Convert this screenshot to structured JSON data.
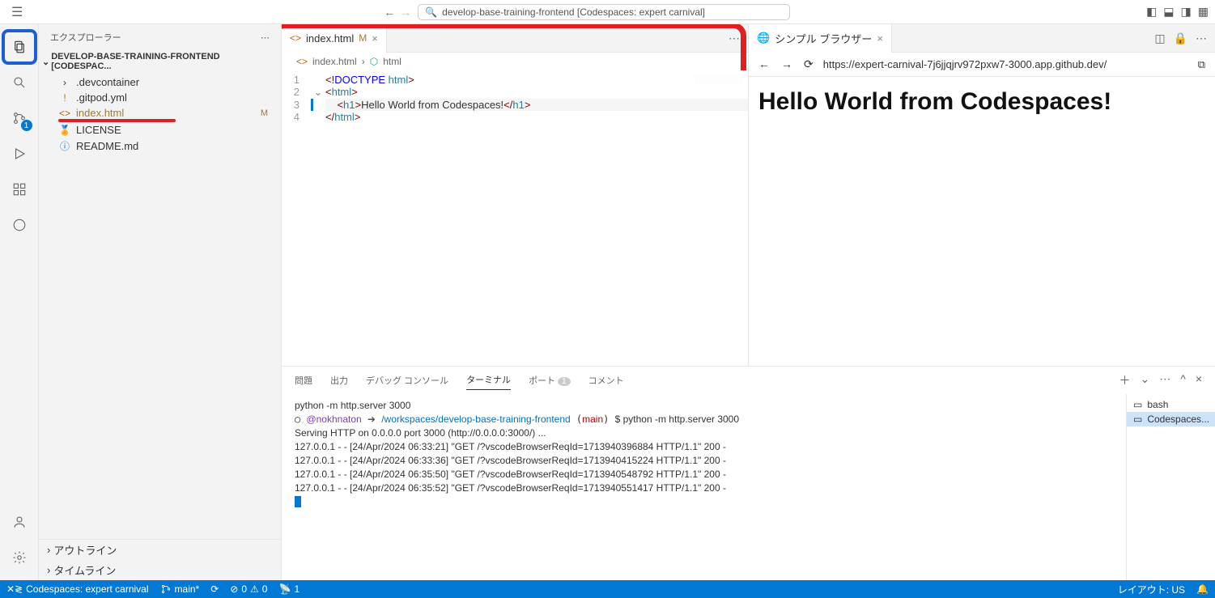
{
  "title_bar": {
    "search_text": "develop-base-training-frontend [Codespaces: expert carnival]"
  },
  "sidebar": {
    "header": "エクスプローラー",
    "project": "DEVELOP-BASE-TRAINING-FRONTEND [CODESPAC...",
    "files": [
      {
        "name": ".devcontainer",
        "icon": "›",
        "modified": false
      },
      {
        "name": ".gitpod.yml",
        "icon": "!",
        "modified": false
      },
      {
        "name": "index.html",
        "icon": "<>",
        "modified": true,
        "status": "M"
      },
      {
        "name": "LICENSE",
        "icon": "🏅",
        "modified": false
      },
      {
        "name": "README.md",
        "icon": "ⓘ",
        "modified": false
      }
    ],
    "outline": "アウトライン",
    "timeline": "タイムライン"
  },
  "editor": {
    "tab_label": "index.html",
    "tab_mod": "M",
    "breadcrumb_1": "index.html",
    "breadcrumb_2": "html",
    "code": {
      "l1": {
        "n": "1",
        "doctype_open": "<!",
        "doctype_kw": "DOCTYPE",
        "doctype_rest": " html",
        "close": ">"
      },
      "l2": {
        "n": "2",
        "open": "<",
        "tag": "html",
        "close": ">"
      },
      "l3": {
        "n": "3",
        "indent": "    ",
        "open": "<",
        "tag": "h1",
        "close": ">",
        "text": "Hello World from Codespaces!",
        "open2": "</",
        "tag2": "h1",
        "close2": ">"
      },
      "l4": {
        "n": "4",
        "open": "</",
        "tag": "html",
        "close": ">"
      }
    }
  },
  "browser": {
    "tab_label": "シンプル ブラウザー",
    "url": "https://expert-carnival-7j6jjqjrv972pxw7-3000.app.github.dev/",
    "heading": "Hello World from Codespaces!"
  },
  "panel": {
    "tabs": {
      "problems": "問題",
      "output": "出力",
      "debug": "デバッグ コンソール",
      "terminal": "ターミナル",
      "ports": "ポート",
      "ports_count": "1",
      "comments": "コメント"
    },
    "terminals": {
      "bash": "bash",
      "codespaces": "Codespaces..."
    },
    "line_pre": "python -m http.server 3000",
    "prompt_user": "@nokhnaton",
    "prompt_arrow": "➜",
    "prompt_path": "/workspaces/develop-base-training-frontend",
    "prompt_branch": "main",
    "prompt_cmd": "$ python -m http.server 3000",
    "line2": "Serving HTTP on 0.0.0.0 port 3000 (http://0.0.0.0:3000/) ...",
    "line3": "127.0.0.1 - - [24/Apr/2024 06:33:21] \"GET /?vscodeBrowserReqId=1713940396884 HTTP/1.1\" 200 -",
    "line4": "127.0.0.1 - - [24/Apr/2024 06:33:36] \"GET /?vscodeBrowserReqId=1713940415224 HTTP/1.1\" 200 -",
    "line5": "127.0.0.1 - - [24/Apr/2024 06:35:50] \"GET /?vscodeBrowserReqId=1713940548792 HTTP/1.1\" 200 -",
    "line6": "127.0.0.1 - - [24/Apr/2024 06:35:52] \"GET /?vscodeBrowserReqId=1713940551417 HTTP/1.1\" 200 -"
  },
  "status": {
    "codespaces": "Codespaces: expert carnival",
    "branch": "main*",
    "sync": "⟳",
    "errors": "0",
    "warnings": "0",
    "ports": "1",
    "layout": "レイアウト: US"
  }
}
